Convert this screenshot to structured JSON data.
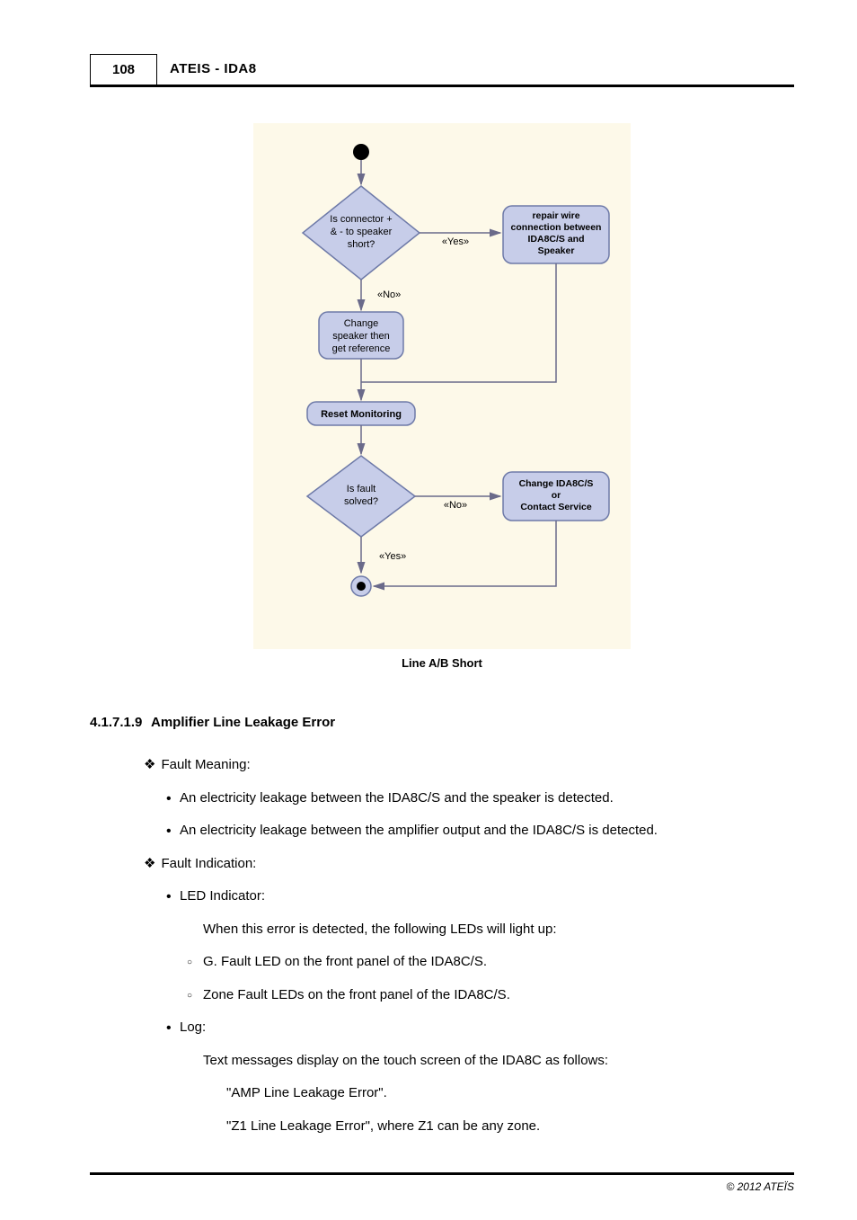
{
  "header": {
    "page_number": "108",
    "doc_title": "ATEIS - IDA8"
  },
  "diagram": {
    "decision1_l1": "Is connector +",
    "decision1_l2": "& - to speaker",
    "decision1_l3": "short?",
    "box_repair_l1": "repair wire",
    "box_repair_l2": "connection between",
    "box_repair_l3": "IDA8C/S and",
    "box_repair_l4": "Speaker",
    "label_yes": "«Yes»",
    "label_no": "«No»",
    "box_change_l1": "Change",
    "box_change_l2": "speaker then",
    "box_change_l3": "get reference",
    "box_reset": "Reset Monitoring",
    "decision2_l1": "Is fault",
    "decision2_l2": "solved?",
    "box_service_l1": "Change IDA8C/S",
    "box_service_l2": "or",
    "box_service_l3": "Contact Service",
    "caption": "Line A/B Short"
  },
  "section": {
    "number": "4.1.7.1.9",
    "title": "Amplifier Line Leakage Error"
  },
  "body": {
    "fault_meaning_label": "Fault Meaning:",
    "fm_item1": "An electricity leakage between the IDA8C/S and the speaker is detected.",
    "fm_item2": "An electricity leakage between the amplifier output and the IDA8C/S is detected.",
    "fault_indication_label": "Fault Indication:",
    "led_label": "LED Indicator:",
    "led_intro": "When this error is detected, the following LEDs will light up:",
    "led_item1": "G. Fault LED on the front panel of the IDA8C/S.",
    "led_item2": "Zone Fault LEDs on the front panel of the IDA8C/S.",
    "log_label": "Log:",
    "log_intro": "Text messages display on the touch screen of the IDA8C as follows:",
    "log_msg1": "\"AMP Line Leakage Error\".",
    "log_msg2": "\"Z1 Line Leakage Error\", where Z1 can be any zone."
  },
  "footer": {
    "copyright": "© 2012 ATEÏS"
  }
}
